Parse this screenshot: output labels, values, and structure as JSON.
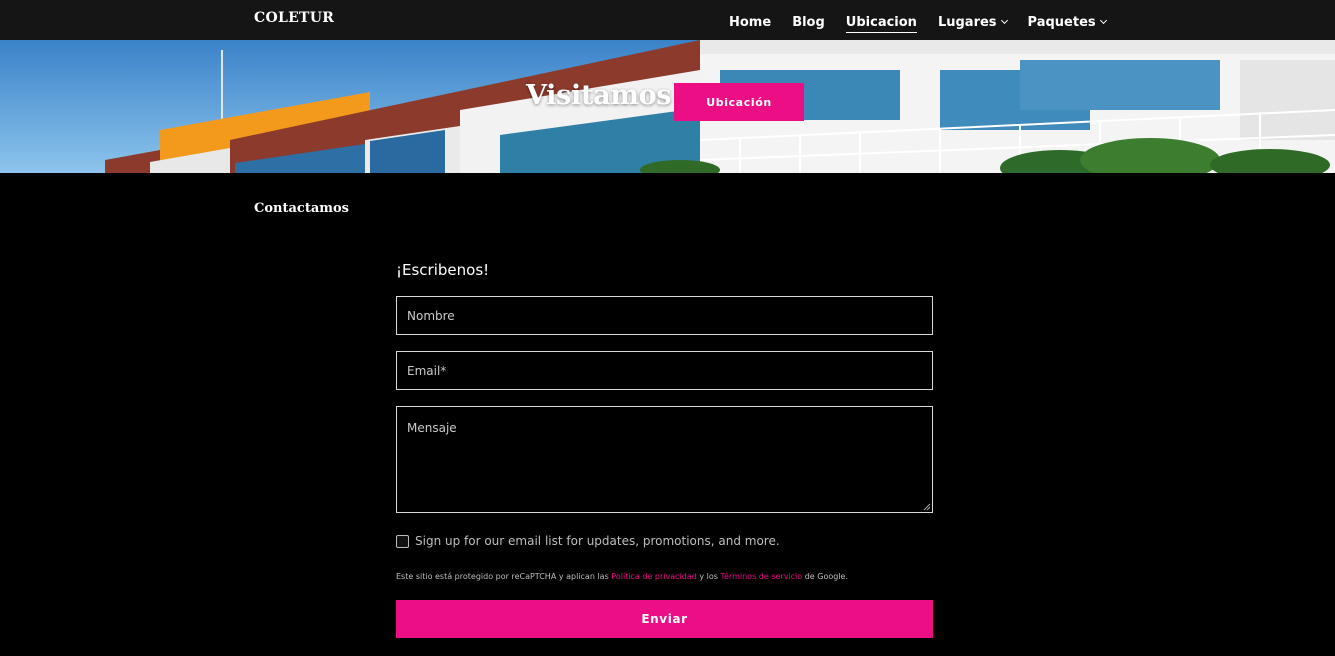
{
  "brand": "COLETUR",
  "nav": {
    "items": [
      {
        "label": "Home"
      },
      {
        "label": "Blog"
      },
      {
        "label": "Ubicacion",
        "active": true
      },
      {
        "label": "Lugares",
        "dropdown": true
      },
      {
        "label": "Paquetes",
        "dropdown": true
      }
    ]
  },
  "hero": {
    "title": "Visitamos",
    "button_label": "Ubicación"
  },
  "contact": {
    "section_title": "Contactamos",
    "form_heading": "¡Escribenos!",
    "name_placeholder": "Nombre",
    "email_placeholder": "Email*",
    "message_placeholder": "Mensaje",
    "signup_label": "Sign up for our email list for updates, promotions, and more.",
    "legal_prefix": "Este sitio está protegido por reCaPTCHA y aplican las ",
    "privacy_link": "Política de privacidad",
    "legal_middle": " y los ",
    "terms_link": "Términos de servicio",
    "legal_suffix": " de Google.",
    "submit_label": "Enviar"
  },
  "colors": {
    "accent": "#ec0e84",
    "nav_bg": "#151515",
    "page_bg": "#000000"
  }
}
